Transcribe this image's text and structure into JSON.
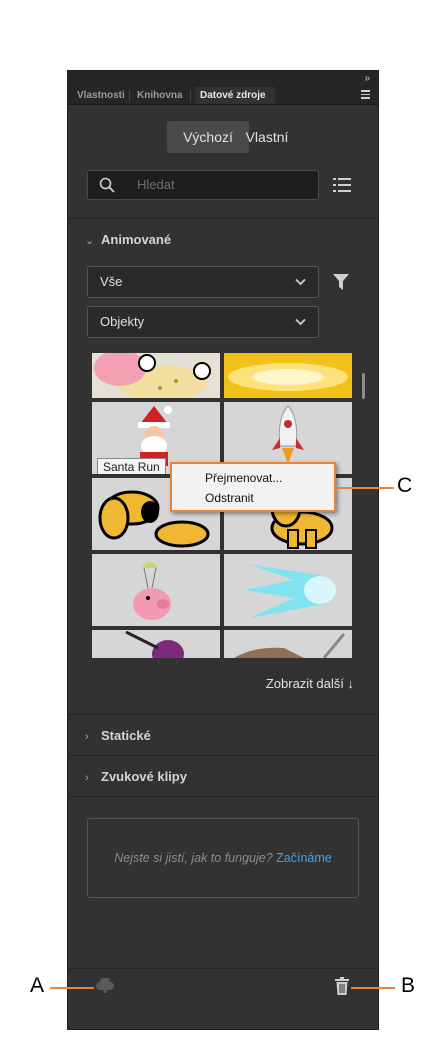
{
  "tabs": [
    "Vlastnosti",
    "Knihovna",
    "Datové zdroje"
  ],
  "segment": {
    "default_label": "Výchozí",
    "custom_label": "Vlastní"
  },
  "search": {
    "placeholder": "Hledat"
  },
  "animated": {
    "title": "Animované",
    "filter_value": "Vše",
    "type_value": "Objekty",
    "tooltip": "Santa Run",
    "show_more": "Zobrazit další ↓"
  },
  "context_menu": {
    "rename": "Přejmenovat...",
    "delete": "Odstranit"
  },
  "sections": {
    "static": "Statické",
    "sound": "Zvukové klipy"
  },
  "help": {
    "question": "Nejste si jistí, jak to funguje?",
    "link": "Začínáme"
  },
  "callouts": {
    "a": "A",
    "b": "B",
    "c": "C"
  },
  "colors": {
    "panel": "#323232",
    "accent": "#e8833a",
    "selection": "#3d8ee6",
    "link": "#4a9ee8"
  },
  "icons": [
    "collapse-icon",
    "panel-menu-icon",
    "search-icon",
    "list-view-icon",
    "chevron-down-icon",
    "filter-icon",
    "chevron-right-icon",
    "upload-cloud-icon",
    "trash-icon"
  ]
}
